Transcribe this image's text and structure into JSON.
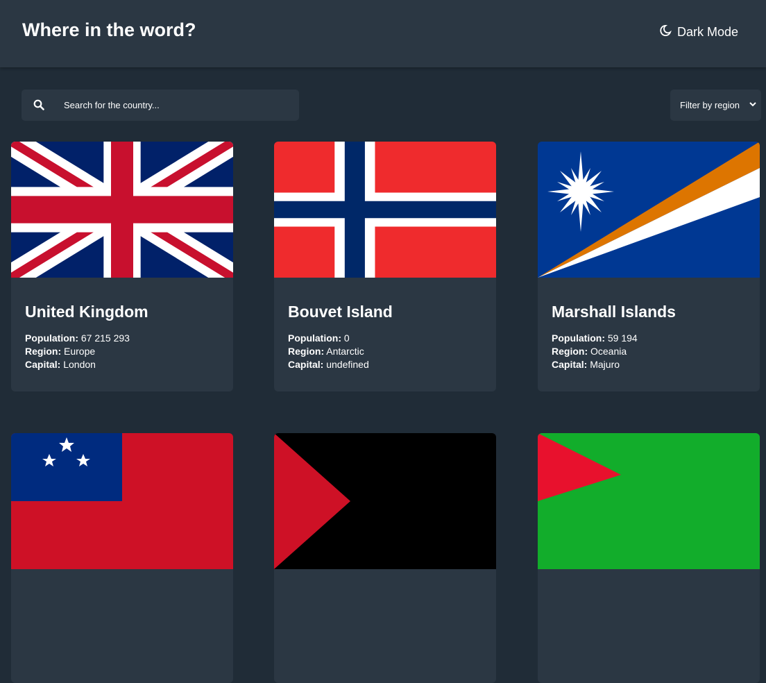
{
  "header": {
    "title": "Where in the word?",
    "theme_label": "Dark Mode"
  },
  "search": {
    "placeholder": "Search for the country..."
  },
  "filter": {
    "label": "Filter by region"
  },
  "field_labels": {
    "population": "Population:",
    "region": "Region:",
    "capital": "Capital:"
  },
  "countries": [
    {
      "name": "United Kingdom",
      "population": "67 215 293",
      "region": "Europe",
      "capital": "London"
    },
    {
      "name": "Bouvet Island",
      "population": "0",
      "region": "Antarctic",
      "capital": "undefined"
    },
    {
      "name": "Marshall Islands",
      "population": "59 194",
      "region": "Oceania",
      "capital": "Majuro"
    }
  ],
  "colors": {
    "background": "#202c37",
    "element": "#2b3743",
    "text": "#ffffff"
  }
}
